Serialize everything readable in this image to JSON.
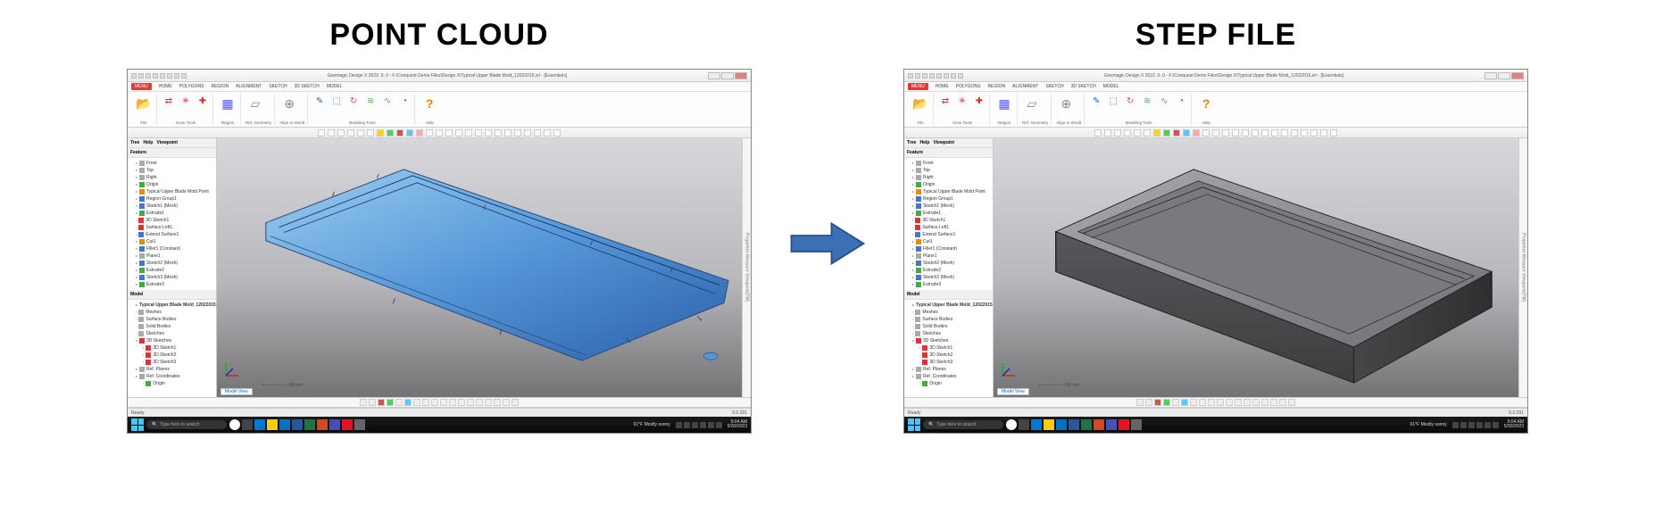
{
  "panels": {
    "left_title": "POINT CLOUD",
    "right_title": "STEP FILE"
  },
  "app": {
    "title": "Geomagic Design X 2022. 0. 0 - F:\\Conquest Demo Files\\Design X\\Typical Upper Blade Mold_12022015.xrl - [Essentials]",
    "menus": [
      "MENU",
      "HOME",
      "POLYGONS",
      "REGION",
      "ALIGNMENT",
      "SKETCH",
      "3D SKETCH",
      "MODEL"
    ],
    "ribbon_groups": [
      {
        "label": "File",
        "items": [
          "Open"
        ]
      },
      {
        "label": "Scan Tools",
        "items": [
          "Align Between Scan Data",
          "Decimate Meshes",
          "Healing Wizard"
        ]
      },
      {
        "label": "Region",
        "items": [
          "Auto Segment"
        ]
      },
      {
        "label": "Ref. Geometry",
        "items": [
          "Plane"
        ]
      },
      {
        "label": "Align to World",
        "items": [
          "Interactive Alignment"
        ]
      },
      {
        "label": "Modeling Tools",
        "items": [
          "3D Sketch",
          "Extrude",
          "Revolve",
          "Loft",
          "Sweep",
          "Fillet"
        ]
      },
      {
        "label": "Help",
        "items": [
          "Context Help"
        ]
      }
    ],
    "sidebar_tabs": [
      "Tree",
      "Help",
      "Viewpoint"
    ],
    "feature_header": "Feature",
    "feature_tree": [
      "Front",
      "Top",
      "Right",
      "Origin",
      "Typical Upper Blade Mold Point",
      "Region Group1",
      "Sketch1 (Mesh)",
      "Extrude1",
      "3D Sketch1",
      "Surface Loft1",
      "Extend Surface1",
      "Cut1",
      "Fillet1 (Constant)",
      "Plane1",
      "Sketch2 (Mesh)",
      "Extrude2",
      "Sketch3 (Mesh)",
      "Extrude3"
    ],
    "model_header": "Model",
    "model_name": "Typical Upper Blade Mold_12022015",
    "model_tree": [
      "Meshes",
      "Surface Bodies",
      "Solid Bodies",
      "Sketches",
      "3D Sketches",
      "3D Sketch1",
      "3D Sketch2",
      "3D Sketch3",
      "Ref. Planes",
      "Ref. Coordinates",
      "Origin"
    ],
    "viewport_tab": "Model View",
    "scale_label": "50 mm",
    "right_panel_label": "Properties  Measure  Viewpoint(TM)"
  },
  "status": {
    "left": "Ready",
    "right": "0.0.291"
  },
  "taskbar": {
    "search_placeholder": "Type here to search",
    "weather": "61°F  Mostly sunny",
    "time": "9:04 AM",
    "date": "5/30/2023"
  },
  "icons": {
    "open": "📂",
    "align": "⇄",
    "decimate": "✳",
    "heal": "✚",
    "segment": "▦",
    "plane": "▱",
    "ialign": "⊕",
    "sketch3d": "✎",
    "extrude": "⬚",
    "revolve": "↻",
    "loft": "≋",
    "sweep": "∿",
    "fillet": "◔",
    "help": "?",
    "search": "🔍",
    "cortana": "○"
  }
}
